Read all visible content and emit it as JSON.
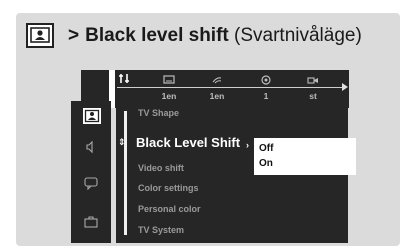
{
  "header": {
    "chevron": ">",
    "title": "Black level shift",
    "title_sv": "(Svartnivåläge)",
    "icon": "picture-setup-icon"
  },
  "top_bar": {
    "icons": [
      "settings-icon",
      "subtitle-icon",
      "audio-icon",
      "angle-icon",
      "camera-icon"
    ],
    "values": [
      "1en",
      "1en",
      "1",
      "st"
    ]
  },
  "sidebar": {
    "items": [
      "picture-icon",
      "audio-icon",
      "subtitle-icon",
      "preference-icon"
    ]
  },
  "menu": {
    "items": [
      "TV Shape",
      "Black Level Shift",
      "Video shift",
      "Color settings",
      "Personal color",
      "TV System"
    ],
    "selected_index": 1
  },
  "popup": {
    "options": [
      "Off",
      "On"
    ]
  },
  "colors": {
    "osd_background": "#262626",
    "frame_background": "#dbdbdb",
    "text_active": "#ffffff",
    "text_inactive": "#9a9a9a"
  }
}
